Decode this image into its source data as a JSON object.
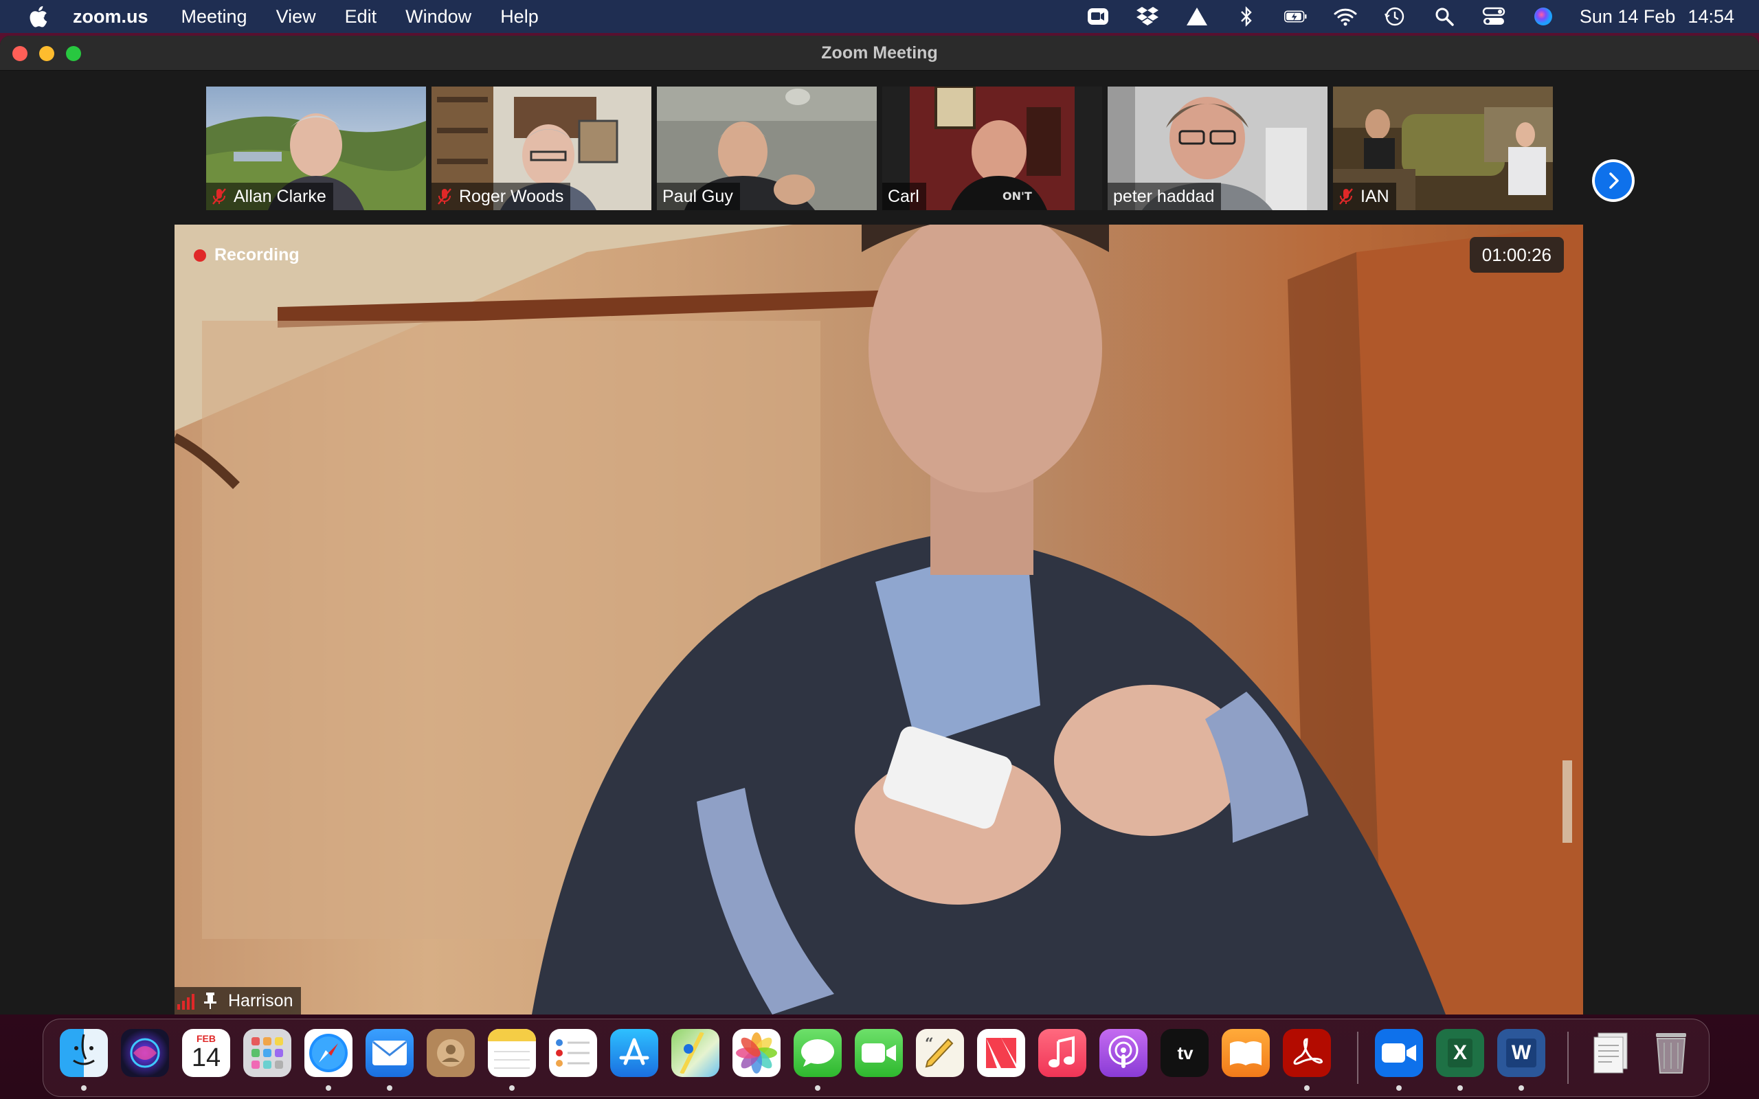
{
  "menubar": {
    "app_name": "zoom.us",
    "menus": [
      "Meeting",
      "View",
      "Edit",
      "Window",
      "Help"
    ],
    "date": "Sun 14 Feb",
    "time": "14:54",
    "status_icons": [
      "zoom-icon",
      "dropbox-icon",
      "drive-icon",
      "bluetooth-icon",
      "battery-icon",
      "wifi-icon",
      "time-machine-icon",
      "spotlight-icon",
      "control-center-icon",
      "siri-icon"
    ]
  },
  "window": {
    "title": "Zoom Meeting"
  },
  "gallery": {
    "participants": [
      {
        "name": "Allan Clarke",
        "muted": true
      },
      {
        "name": "Roger Woods",
        "muted": true
      },
      {
        "name": "Paul Guy",
        "muted": false
      },
      {
        "name": "Carl",
        "muted": false
      },
      {
        "name": "peter haddad",
        "muted": false
      },
      {
        "name": "IAN",
        "muted": true
      }
    ]
  },
  "main": {
    "recording_label": "Recording",
    "timer": "01:00:26",
    "speaker_name": "Harrison"
  },
  "dock": {
    "calendar_month": "FEB",
    "calendar_day": "14",
    "apps": [
      "Finder",
      "Siri",
      "Calendar",
      "Launchpad",
      "Safari",
      "Mail",
      "Contacts",
      "Notes",
      "Reminders",
      "App Store",
      "Maps",
      "Photos",
      "Messages",
      "FaceTime",
      "Script Editor",
      "News",
      "Music",
      "Podcasts",
      "TV",
      "Books",
      "Acrobat Reader",
      "Zoom",
      "Excel",
      "Word",
      "Documents",
      "Trash"
    ],
    "tv_label": "tv",
    "excel_letter": "X",
    "word_letter": "W",
    "colors": {
      "zoom_blue": "#0e71eb",
      "record_red": "#e02828"
    }
  }
}
